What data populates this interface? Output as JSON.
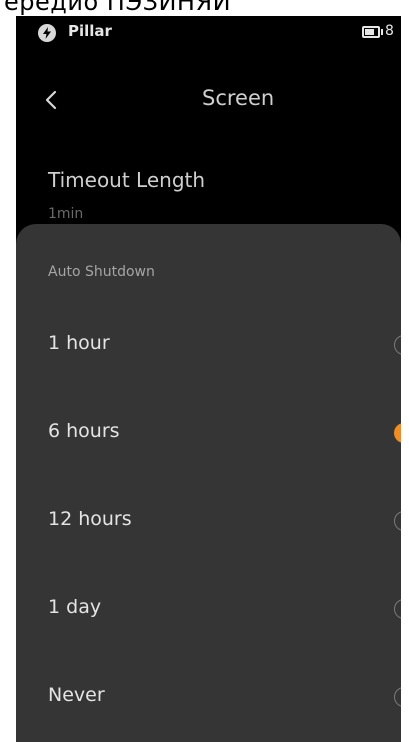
{
  "top_strip": {
    "text": "ередио ПЭЗИНЯЙ"
  },
  "status_bar": {
    "brand": "Pillar",
    "battery_text": "8"
  },
  "nav": {
    "title": "Screen"
  },
  "setting": {
    "title": "Timeout Length",
    "value": "1min"
  },
  "sheet": {
    "title": "Auto Shutdown",
    "options": [
      {
        "label": "1 hour",
        "selected": false
      },
      {
        "label": "6 hours",
        "selected": true
      },
      {
        "label": "12 hours",
        "selected": false
      },
      {
        "label": "1 day",
        "selected": false
      },
      {
        "label": "Never",
        "selected": false
      }
    ]
  },
  "colors": {
    "accent": "#f28c1c",
    "sheet_background": "#353535",
    "screen_background": "#000000"
  }
}
